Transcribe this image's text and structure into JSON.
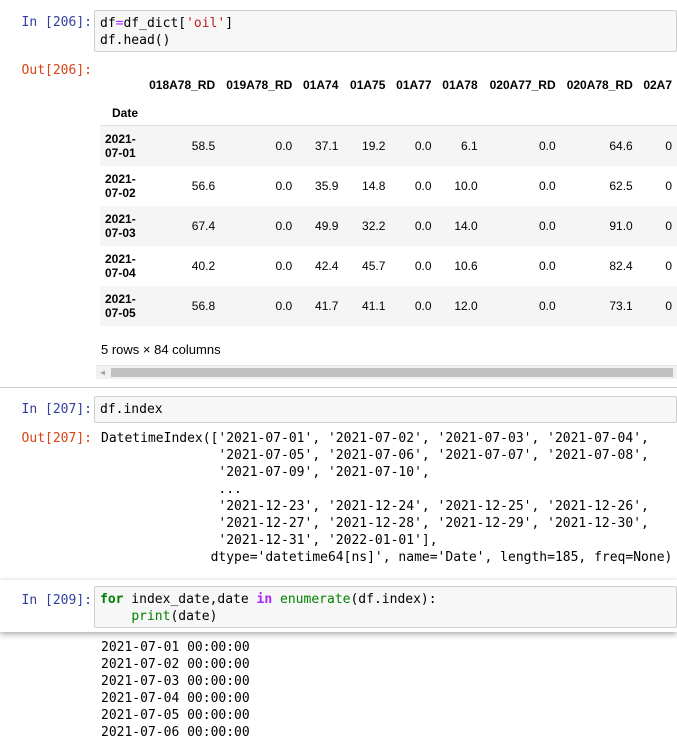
{
  "cells": [
    {
      "in_prompt": "In [206]:",
      "code_lines": [
        {
          "a": "df",
          "b": "=",
          "c": "df_dict[",
          "d": "'oil'",
          "e": "]"
        },
        {
          "plain": "df.head()"
        }
      ],
      "out_prompt": "Out[206]:",
      "dataframe": {
        "columns": [
          "018A78_RD",
          "019A78_RD",
          "01A74",
          "01A75",
          "01A77",
          "01A78",
          "020A77_RD",
          "020A78_RD",
          "02A7"
        ],
        "index_name": "Date",
        "rows": [
          {
            "date_a": "2021-",
            "date_b": "07-01",
            "values": [
              "58.5",
              "0.0",
              "37.1",
              "19.2",
              "0.0",
              "6.1",
              "0.0",
              "64.6",
              "0"
            ]
          },
          {
            "date_a": "2021-",
            "date_b": "07-02",
            "values": [
              "56.6",
              "0.0",
              "35.9",
              "14.8",
              "0.0",
              "10.0",
              "0.0",
              "62.5",
              "0"
            ]
          },
          {
            "date_a": "2021-",
            "date_b": "07-03",
            "values": [
              "67.4",
              "0.0",
              "49.9",
              "32.2",
              "0.0",
              "14.0",
              "0.0",
              "91.0",
              "0"
            ]
          },
          {
            "date_a": "2021-",
            "date_b": "07-04",
            "values": [
              "40.2",
              "0.0",
              "42.4",
              "45.7",
              "0.0",
              "10.6",
              "0.0",
              "82.4",
              "0"
            ]
          },
          {
            "date_a": "2021-",
            "date_b": "07-05",
            "values": [
              "56.8",
              "0.0",
              "41.7",
              "41.1",
              "0.0",
              "12.0",
              "0.0",
              "73.1",
              "0"
            ]
          }
        ],
        "shape_text": "5 rows × 84 columns"
      }
    },
    {
      "in_prompt": "In [207]:",
      "code": "df.index",
      "out_prompt": "Out[207]:",
      "output_lines": [
        "DatetimeIndex(['2021-07-01', '2021-07-02', '2021-07-03', '2021-07-04',",
        "               '2021-07-05', '2021-07-06', '2021-07-07', '2021-07-08',",
        "               '2021-07-09', '2021-07-10',",
        "               ...",
        "               '2021-12-23', '2021-12-24', '2021-12-25', '2021-12-26',",
        "               '2021-12-27', '2021-12-28', '2021-12-29', '2021-12-30',",
        "               '2021-12-31', '2022-01-01'],",
        "              dtype='datetime64[ns]', name='Date', length=185, freq=None)"
      ]
    },
    {
      "in_prompt": "In [209]:",
      "code_kw_for": "for",
      "code_vars": " index_date,date ",
      "code_kw_in": "in",
      "code_builtin_enum": "enumerate",
      "code_rest1": "(df.index):",
      "code_indent": "    ",
      "code_builtin_print": "print",
      "code_rest2": "(date)",
      "output_lines": [
        "2021-07-01 00:00:00",
        "2021-07-02 00:00:00",
        "2021-07-03 00:00:00",
        "2021-07-04 00:00:00",
        "2021-07-05 00:00:00",
        "2021-07-06 00:00:00"
      ]
    }
  ],
  "colors": {
    "in_prompt": "#303F9F",
    "out_prompt": "#D84315",
    "input_bg": "#f7f7f7",
    "string": "#ba2121",
    "keyword": "#008000",
    "operator": "#aa22ff"
  }
}
